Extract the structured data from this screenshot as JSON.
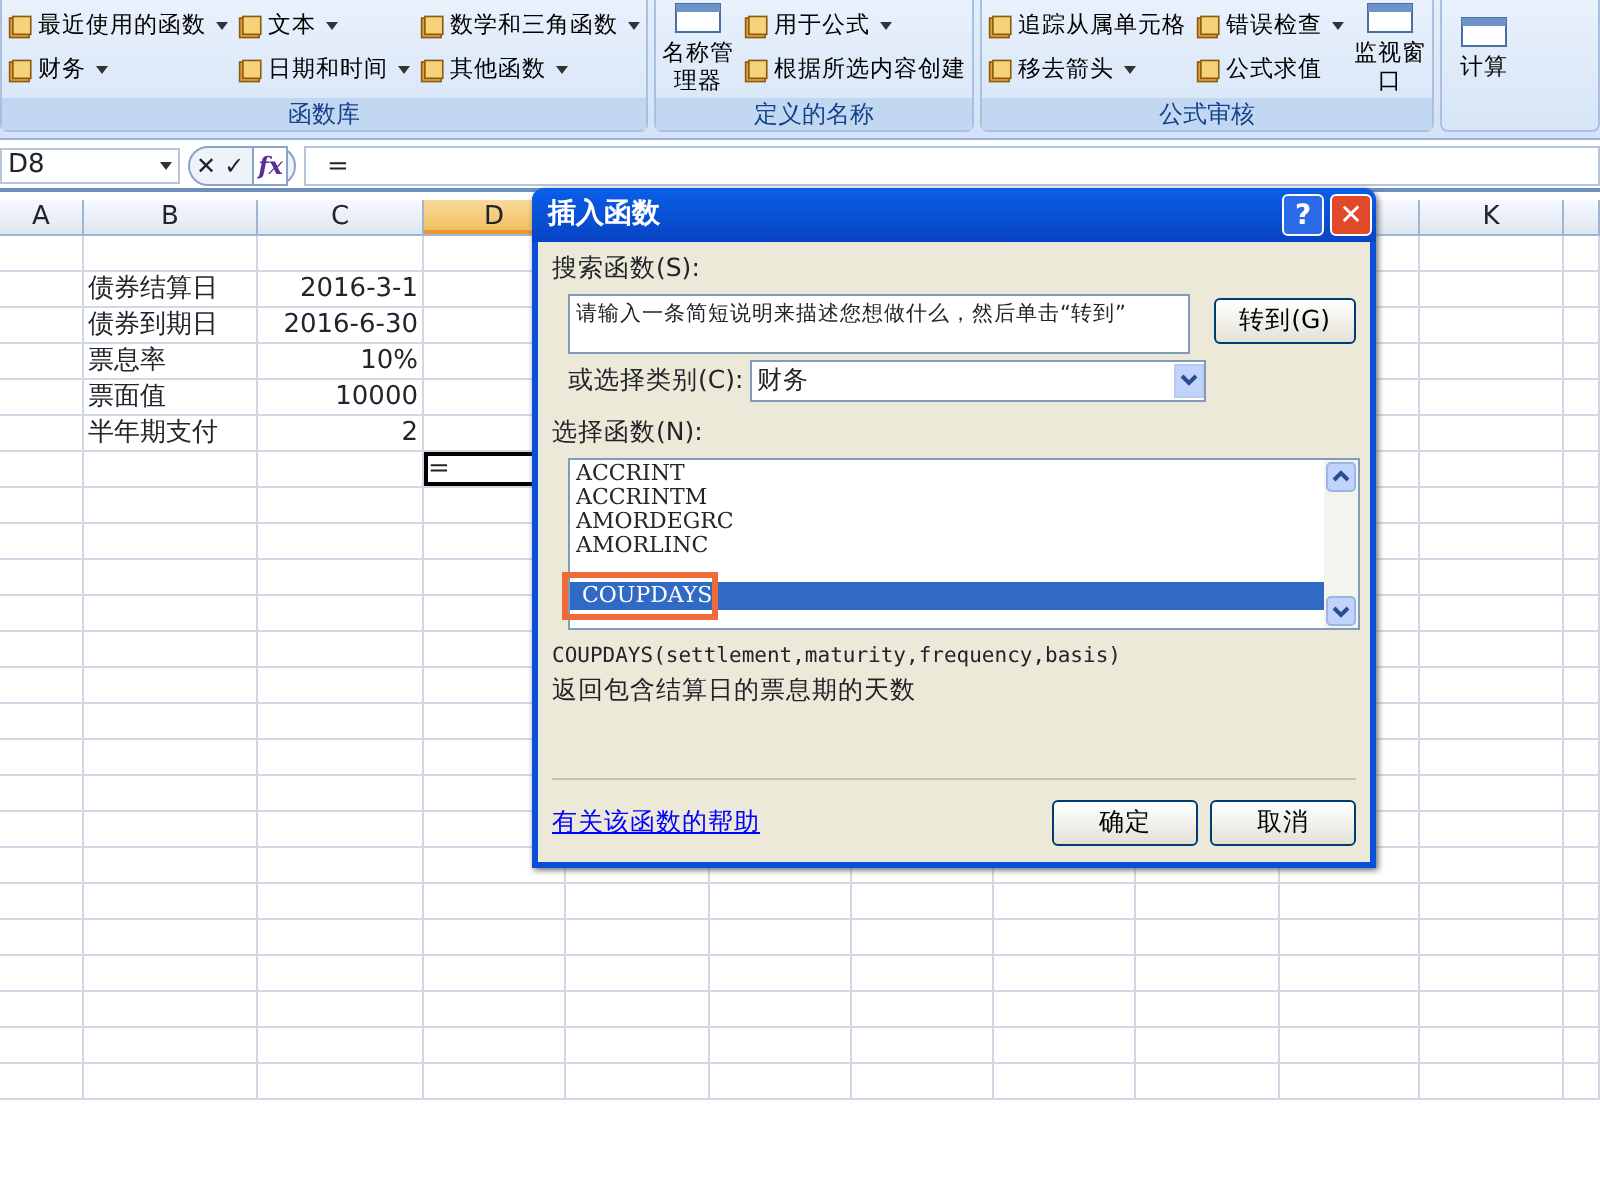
{
  "ribbon": {
    "groups": [
      {
        "label": "函数库",
        "items": [
          {
            "kind": "small",
            "text": "最近使用的函数",
            "dropdown": true
          },
          {
            "kind": "small",
            "text": "财务",
            "dropdown": true
          },
          {
            "kind": "small",
            "text": "文本",
            "dropdown": true
          },
          {
            "kind": "small",
            "text": "日期和时间",
            "dropdown": true
          },
          {
            "kind": "small",
            "text": "数学和三角函数",
            "dropdown": true
          },
          {
            "kind": "small",
            "text": "其他函数",
            "dropdown": true
          }
        ]
      },
      {
        "label": "定义的名称",
        "items": [
          {
            "kind": "large",
            "text": "名称管理器",
            "dropdown": false
          },
          {
            "kind": "small",
            "text": "用于公式",
            "dropdown": true
          },
          {
            "kind": "small",
            "text": "根据所选内容创建",
            "dropdown": false
          }
        ]
      },
      {
        "label": "公式审核",
        "items": [
          {
            "kind": "small",
            "text": "追踪从属单元格",
            "dropdown": false
          },
          {
            "kind": "small",
            "text": "移去箭头",
            "dropdown": true
          },
          {
            "kind": "small",
            "text": "错误检查",
            "dropdown": true
          },
          {
            "kind": "small",
            "text": "公式求值",
            "dropdown": false
          },
          {
            "kind": "large",
            "text": "监视窗口",
            "dropdown": false
          }
        ]
      },
      {
        "items": [
          {
            "kind": "large",
            "text": "计算",
            "dropdown": false
          }
        ]
      }
    ]
  },
  "formula_bar": {
    "name_box": "D8",
    "cancel": "✕",
    "enter": "✓",
    "insert_function": "fx",
    "formula": "="
  },
  "grid": {
    "columns": [
      {
        "label": "A",
        "selected": false
      },
      {
        "label": "B",
        "selected": false
      },
      {
        "label": "C",
        "selected": false
      },
      {
        "label": "D",
        "selected": true
      },
      {
        "label": "K",
        "selected": false
      }
    ],
    "rows": [
      {
        "label": "债券结算日",
        "value": "2016-3-1"
      },
      {
        "label": "债券到期日",
        "value": "2016-6-30"
      },
      {
        "label": "票息率",
        "value": "10%"
      },
      {
        "label": "票面值",
        "value": "10000"
      },
      {
        "label": "半年期支付",
        "value": "2"
      }
    ],
    "active_cell": {
      "text": "="
    }
  },
  "dialog": {
    "title": "插入函数",
    "help_button": "?",
    "close_button": "✕",
    "search_label": "搜索函数(S):",
    "search_value": "请输入一条简短说明来描述您想做什么，然后单击“转到”",
    "go_button": "转到(G)",
    "category_label": "或选择类别(C):",
    "category_value": "财务",
    "list_label": "选择函数(N):",
    "functions": [
      {
        "name": "ACCRINT",
        "selected": false,
        "highlighted": false
      },
      {
        "name": "ACCRINTM",
        "selected": false,
        "highlighted": false
      },
      {
        "name": "AMORDEGRC",
        "selected": false,
        "highlighted": false
      },
      {
        "name": "AMORLINC",
        "selected": false,
        "highlighted": false
      },
      {
        "name": "COUPDAYS",
        "selected": true,
        "highlighted": true
      }
    ],
    "signature": "COUPDAYS(settlement,maturity,frequency,basis)",
    "description": "返回包含结算日的票息期的天数",
    "help_link": "有关该函数的帮助",
    "ok_button": "确定",
    "cancel_button": "取消"
  }
}
